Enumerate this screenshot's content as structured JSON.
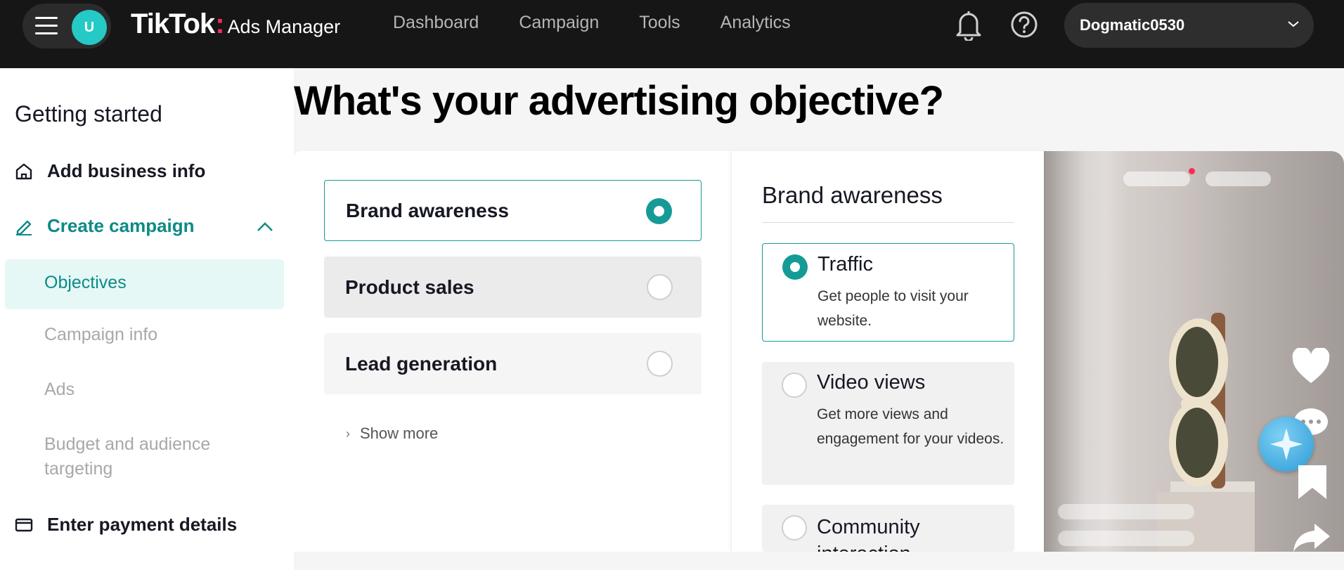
{
  "header": {
    "avatar_initial": "U",
    "logo_brand": "TikTok",
    "logo_product": "Ads Manager",
    "nav": [
      "Dashboard",
      "Campaign",
      "Tools",
      "Analytics"
    ],
    "account_name": "Dogmatic0530",
    "icons": [
      "menu-icon",
      "bell-icon",
      "help-icon",
      "chevron-down-icon"
    ]
  },
  "sidebar": {
    "title": "Getting started",
    "steps": [
      {
        "label": "Add business info",
        "icon": "home-icon"
      },
      {
        "label": "Create campaign",
        "icon": "pencil-icon",
        "expanded": true
      },
      {
        "label": "Enter payment details",
        "icon": "card-icon"
      }
    ],
    "sub_items": [
      "Objectives",
      "Campaign info",
      "Ads",
      "Budget and audience targeting"
    ],
    "active_sub": "Objectives"
  },
  "main": {
    "heading": "What's your advertising objective?",
    "objectives": [
      {
        "label": "Brand awareness",
        "selected": true
      },
      {
        "label": "Product sales",
        "selected": false
      },
      {
        "label": "Lead generation",
        "selected": false
      }
    ],
    "show_more": "Show more",
    "detail": {
      "title": "Brand awareness",
      "options": [
        {
          "title": "Traffic",
          "desc": "Get people to visit your website.",
          "selected": true
        },
        {
          "title": "Video views",
          "desc": "Get more views and engagement for your videos.",
          "selected": false
        },
        {
          "title": "Community interaction",
          "desc": "",
          "selected": false
        }
      ]
    }
  },
  "colors": {
    "accent": "#149b97",
    "accent_text": "#0e8a86",
    "active_bg": "#e5f8f6",
    "topbar": "#161616",
    "avatar": "#25c9c5"
  }
}
